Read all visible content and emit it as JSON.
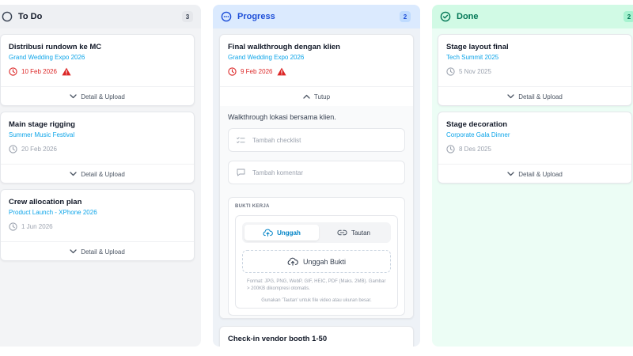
{
  "columns": {
    "todo": {
      "title": "To Do",
      "count": "3",
      "cards": [
        {
          "title": "Distribusi rundown ke MC",
          "event": "Grand Wedding Expo 2026",
          "date": "10 Feb 2026",
          "overdue": true,
          "footer": "Detail & Upload"
        },
        {
          "title": "Main stage rigging",
          "event": "Summer Music Festival",
          "date": "20 Feb 2026",
          "overdue": false,
          "footer": "Detail & Upload"
        },
        {
          "title": "Crew allocation plan",
          "event": "Product Launch - XPhone 2026",
          "date": "1 Jun 2026",
          "overdue": false,
          "footer": "Detail & Upload"
        }
      ]
    },
    "progress": {
      "title": "Progress",
      "count": "2",
      "cards": [
        {
          "title": "Final walkthrough dengan klien",
          "event": "Grand Wedding Expo 2026",
          "date": "9 Feb 2026",
          "overdue": true,
          "footer": "Tutup",
          "description": "Walkthrough lokasi bersama klien.",
          "checklist_placeholder": "Tambah checklist",
          "comment_placeholder": "Tambah komentar",
          "proof": {
            "label": "BUKTI KERJA",
            "tab_upload": "Unggah",
            "tab_link": "Tautan",
            "dropzone": "Unggah Bukti",
            "format_note": "Format: JPG, PNG, WebP, GIF, HEIC, PDF (Maks. 2MB). Gambar > 200KB dikompresi otomatis.",
            "hint": "Gunakan 'Tautan' untuk file video atau ukuran besar."
          }
        },
        {
          "title": "Check-in vendor booth 1-50"
        }
      ]
    },
    "done": {
      "title": "Done",
      "count": "2",
      "cards": [
        {
          "title": "Stage layout final",
          "event": "Tech Summit 2025",
          "date": "5 Nov 2025",
          "overdue": false,
          "footer": "Detail & Upload"
        },
        {
          "title": "Stage decoration",
          "event": "Corporate Gala Dinner",
          "date": "8 Des 2025",
          "overdue": false,
          "footer": "Detail & Upload"
        }
      ]
    }
  },
  "icons": {
    "todo": "circle-icon",
    "progress": "dots-circle-icon",
    "done": "check-circle-icon",
    "date": "clock-icon",
    "overdue": "warning-icon",
    "expand": "chevron-down-icon",
    "collapse": "chevron-up-icon",
    "checklist": "checklist-icon",
    "comment": "comment-icon",
    "upload": "cloud-upload-icon",
    "link": "link-icon"
  },
  "colors": {
    "accent_blue": "#1d4ed8",
    "link_blue": "#0ea5e9",
    "overdue_red": "#dc2626",
    "done_green": "#047857",
    "todo_bg": "#f3f4f6",
    "progress_bg": "#eef2f7",
    "done_bg": "#ecfdf5"
  }
}
